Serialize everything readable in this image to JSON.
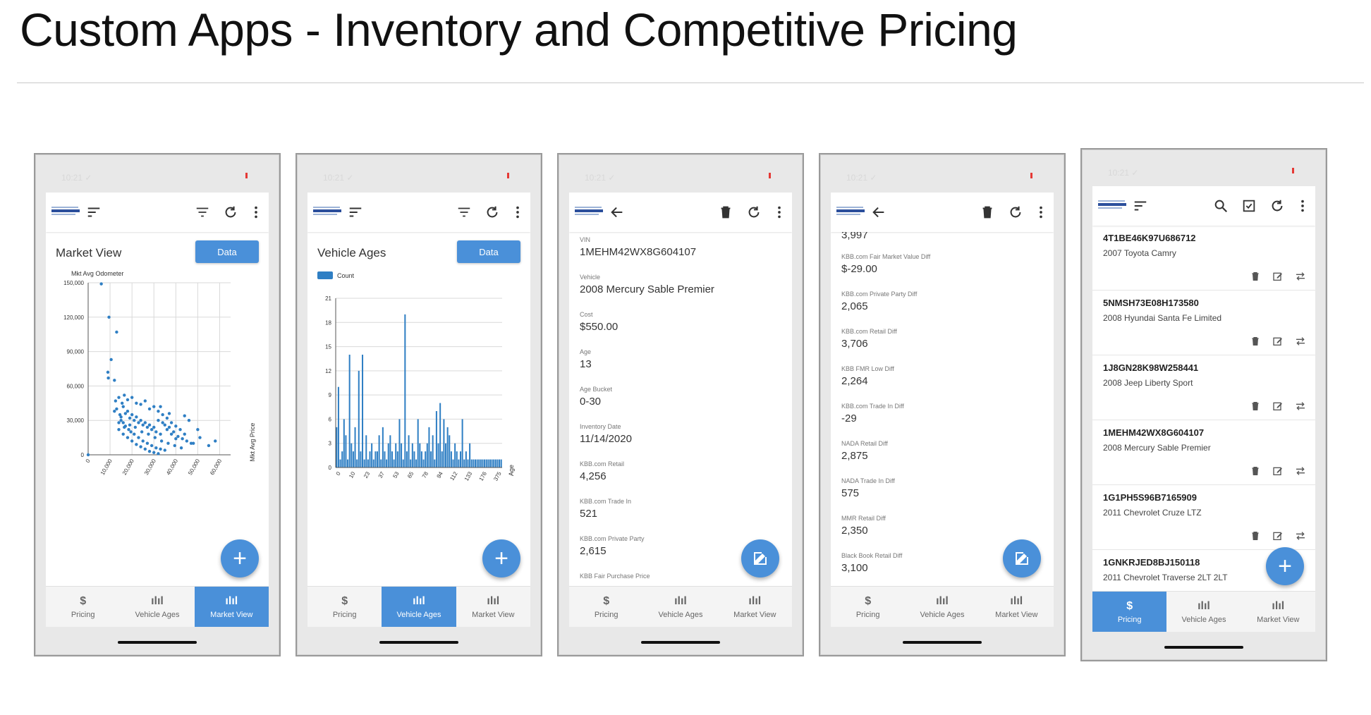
{
  "slide": {
    "title": "Custom Apps - Inventory and Competitive Pricing"
  },
  "status": {
    "time": "10:21 ✓"
  },
  "nav": {
    "pricing": "Pricing",
    "vehicle_ages": "Vehicle Ages",
    "market_view": "Market View",
    "pricing_icon": "$",
    "chart_icon": "ılıl"
  },
  "screen1": {
    "heading": "Market View",
    "data_button": "Data",
    "fab": "+",
    "chart_data": {
      "type": "scatter",
      "title": "",
      "ylabel": "Mkt Avg Odometer",
      "xlabel": "Mkt Avg Price",
      "x_ticks": [
        "0",
        "10,000",
        "20,000",
        "30,000",
        "40,000",
        "50,000",
        "60,000"
      ],
      "y_ticks": [
        "0",
        "30,000",
        "60,000",
        "90,000",
        "120,000",
        "150,000"
      ],
      "xlim": [
        0,
        65000
      ],
      "ylim": [
        0,
        150000
      ],
      "grid": true,
      "points": [
        [
          6000,
          149000
        ],
        [
          9500,
          120000
        ],
        [
          13000,
          107000
        ],
        [
          10500,
          83000
        ],
        [
          9000,
          72000
        ],
        [
          9200,
          67000
        ],
        [
          12000,
          65000
        ],
        [
          12500,
          47000
        ],
        [
          14000,
          50000
        ],
        [
          15500,
          45000
        ],
        [
          16500,
          52000
        ],
        [
          18000,
          48000
        ],
        [
          20000,
          50000
        ],
        [
          22000,
          45000
        ],
        [
          24000,
          44000
        ],
        [
          26000,
          47000
        ],
        [
          28000,
          40000
        ],
        [
          30000,
          42000
        ],
        [
          32000,
          38000
        ],
        [
          34000,
          35000
        ],
        [
          36000,
          32000
        ],
        [
          38000,
          28000
        ],
        [
          40000,
          25000
        ],
        [
          42000,
          22000
        ],
        [
          44000,
          18000
        ],
        [
          13000,
          40000
        ],
        [
          14500,
          35000
        ],
        [
          15000,
          30000
        ],
        [
          16000,
          28000
        ],
        [
          17000,
          25000
        ],
        [
          18500,
          22000
        ],
        [
          19500,
          20000
        ],
        [
          21000,
          18000
        ],
        [
          23000,
          15000
        ],
        [
          25000,
          12000
        ],
        [
          27000,
          10000
        ],
        [
          29000,
          8000
        ],
        [
          31000,
          6000
        ],
        [
          33000,
          5000
        ],
        [
          35000,
          4000
        ],
        [
          14000,
          22000
        ],
        [
          16000,
          18000
        ],
        [
          18000,
          15000
        ],
        [
          20000,
          12000
        ],
        [
          22000,
          9000
        ],
        [
          24000,
          7000
        ],
        [
          26000,
          5000
        ],
        [
          28000,
          3000
        ],
        [
          30000,
          2000
        ],
        [
          32000,
          1000
        ],
        [
          15000,
          33000
        ],
        [
          17000,
          36000
        ],
        [
          19000,
          32000
        ],
        [
          21000,
          30000
        ],
        [
          23000,
          28000
        ],
        [
          25000,
          26000
        ],
        [
          27000,
          24000
        ],
        [
          29000,
          22000
        ],
        [
          31000,
          20000
        ],
        [
          33000,
          18000
        ],
        [
          35000,
          26000
        ],
        [
          37000,
          24000
        ],
        [
          39000,
          20000
        ],
        [
          41000,
          16000
        ],
        [
          43000,
          14000
        ],
        [
          45000,
          12000
        ],
        [
          47000,
          10000
        ],
        [
          16000,
          42000
        ],
        [
          18000,
          38000
        ],
        [
          20000,
          35000
        ],
        [
          22000,
          33000
        ],
        [
          24000,
          30000
        ],
        [
          26000,
          28000
        ],
        [
          28000,
          26000
        ],
        [
          30000,
          24000
        ],
        [
          32000,
          30000
        ],
        [
          34000,
          28000
        ],
        [
          36000,
          22000
        ],
        [
          38000,
          18000
        ],
        [
          40000,
          14000
        ],
        [
          48000,
          10000
        ],
        [
          51000,
          15000
        ],
        [
          58000,
          12000
        ],
        [
          55000,
          8000
        ],
        [
          50000,
          22000
        ],
        [
          0,
          0
        ],
        [
          12000,
          38000
        ],
        [
          14000,
          28000
        ],
        [
          16500,
          24000
        ],
        [
          19000,
          26000
        ],
        [
          21500,
          24000
        ],
        [
          24500,
          20000
        ],
        [
          27500,
          18000
        ],
        [
          30500,
          15000
        ],
        [
          33500,
          12000
        ],
        [
          36500,
          10000
        ],
        [
          39500,
          8000
        ],
        [
          42500,
          6000
        ],
        [
          46000,
          30000
        ],
        [
          44000,
          34000
        ],
        [
          37000,
          36000
        ],
        [
          33000,
          42000
        ]
      ]
    }
  },
  "screen2": {
    "heading": "Vehicle Ages",
    "data_button": "Data",
    "fab": "+",
    "chart_data": {
      "type": "bar",
      "title": "",
      "legend": [
        "Count"
      ],
      "xlabel": "Age",
      "ylabel": "",
      "x_ticks": [
        "0",
        "10",
        "23",
        "37",
        "53",
        "65",
        "78",
        "94",
        "112",
        "133",
        "176",
        "375"
      ],
      "y_ticks": [
        "0",
        "3",
        "6",
        "9",
        "12",
        "15",
        "18",
        "21"
      ],
      "ylim": [
        0,
        21
      ],
      "series": [
        {
          "name": "Count",
          "values": [
            5,
            10,
            1,
            2,
            6,
            4,
            1,
            14,
            3,
            2,
            5,
            1,
            12,
            2,
            14,
            1,
            4,
            1,
            2,
            3,
            1,
            2,
            2,
            4,
            1,
            5,
            2,
            1,
            3,
            4,
            2,
            1,
            3,
            2,
            6,
            3,
            1,
            19,
            2,
            4,
            1,
            3,
            2,
            1,
            6,
            3,
            2,
            1,
            2,
            3,
            5,
            2,
            4,
            1,
            7,
            3,
            8,
            2,
            6,
            3,
            5,
            4,
            2,
            1,
            3,
            2,
            1,
            2,
            6,
            1,
            2,
            1,
            3,
            1,
            1,
            1,
            1,
            1,
            1,
            1,
            1,
            1,
            1,
            1,
            1,
            1,
            1,
            1,
            1,
            1
          ]
        }
      ]
    }
  },
  "screen3": {
    "fab": "✎",
    "fields": [
      {
        "label": "VIN",
        "value": "1MEHM42WX8G604107"
      },
      {
        "label": "Vehicle",
        "value": "2008 Mercury Sable Premier"
      },
      {
        "label": "Cost",
        "value": "$550.00"
      },
      {
        "label": "Age",
        "value": "13"
      },
      {
        "label": "Age Bucket",
        "value": "0-30"
      },
      {
        "label": "Inventory Date",
        "value": "11/14/2020"
      },
      {
        "label": "KBB.com Retail",
        "value": "4,256"
      },
      {
        "label": "KBB.com Trade In",
        "value": "521"
      },
      {
        "label": "KBB.com Private Party",
        "value": "2,615"
      },
      {
        "label": "KBB Fair Purchase Price",
        "value": ""
      }
    ]
  },
  "screen4": {
    "fab": "✎",
    "top_value": "3,997",
    "fields": [
      {
        "label": "KBB.com Fair Market Value Diff",
        "value": "$-29.00"
      },
      {
        "label": "KBB.com Private Party Diff",
        "value": "2,065"
      },
      {
        "label": "KBB.com Retail Diff",
        "value": "3,706"
      },
      {
        "label": "KBB FMR Low Diff",
        "value": "2,264"
      },
      {
        "label": "KBB.com Trade In Diff",
        "value": "-29"
      },
      {
        "label": "NADA Retail Diff",
        "value": "2,875"
      },
      {
        "label": "NADA Trade In Diff",
        "value": "575"
      },
      {
        "label": "MMR Retail Diff",
        "value": "2,350"
      },
      {
        "label": "Black Book Retail Diff",
        "value": "3,100"
      }
    ]
  },
  "screen5": {
    "fab": "+",
    "items": [
      {
        "vin": "4T1BE46K97U686712",
        "name": "2007 Toyota Camry"
      },
      {
        "vin": "5NMSH73E08H173580",
        "name": "2008 Hyundai Santa Fe Limited"
      },
      {
        "vin": "1J8GN28K98W258441",
        "name": "2008 Jeep Liberty Sport"
      },
      {
        "vin": "1MEHM42WX8G604107",
        "name": "2008 Mercury Sable Premier"
      },
      {
        "vin": "1G1PH5S96B7165909",
        "name": "2011 Chevrolet Cruze LTZ"
      },
      {
        "vin": "1GNKRJED8BJ150118",
        "name": "2011 Chevrolet Traverse 2LT 2LT"
      }
    ]
  },
  "colors": {
    "accent": "#4a90d9",
    "point": "#2f7fc4",
    "bar": "#2f7fc4",
    "grid": "#d9d9d9"
  }
}
